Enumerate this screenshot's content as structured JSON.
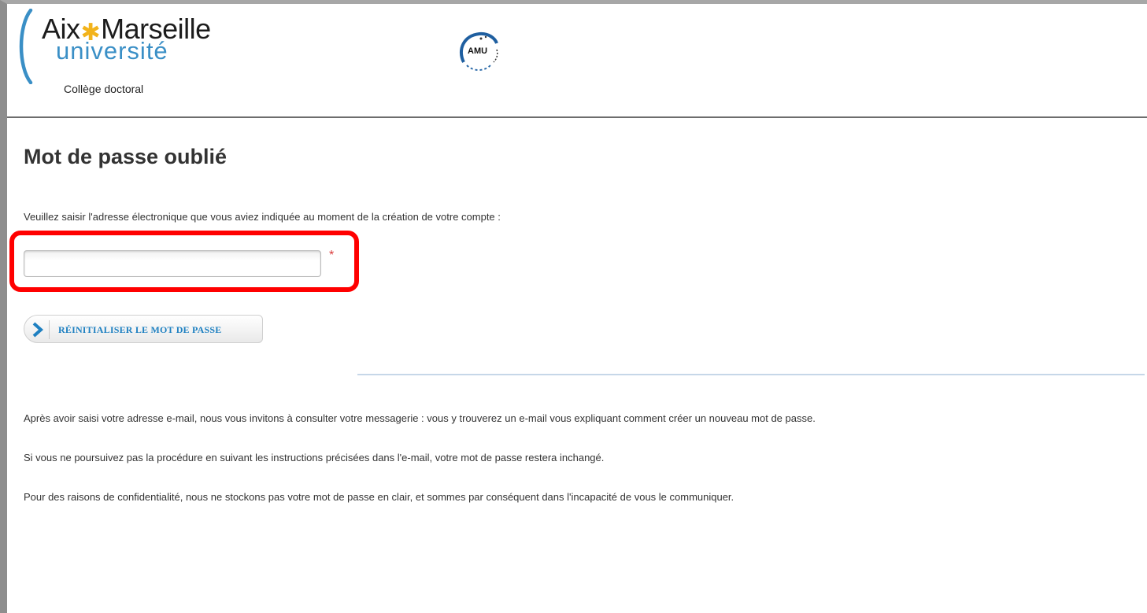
{
  "header": {
    "brand_line1_left": "Aix",
    "brand_line1_right": "Marseille",
    "brand_line2": "université",
    "brand_line3": "Collège doctoral",
    "seal_text": "AMU"
  },
  "main": {
    "title": "Mot de passe oublié",
    "instruction": "Veuillez saisir l'adresse électronique que vous aviez indiquée au moment de la création de votre compte :",
    "email_input": {
      "value": "",
      "placeholder": ""
    },
    "required_mark": "*",
    "reset_button_label": "RÉINITIALISER LE MOT DE PASSE",
    "info_paragraphs": [
      "Après avoir saisi votre adresse e-mail, nous vous invitons à consulter votre messagerie : vous y trouverez un e-mail vous expliquant comment créer un nouveau mot de passe.",
      "Si vous ne poursuivez pas la procédure en suivant les instructions précisées dans l'e-mail, votre mot de passe restera inchangé.",
      "Pour des raisons de confidentialité, nous ne stockons pas votre mot de passe en clair, et sommes par conséquent dans l'incapacité de vous le communiquer."
    ]
  },
  "icons": {
    "button_chevron": "chevron-right-icon",
    "brand_star": "asterisk-icon"
  },
  "colors": {
    "brand_blue": "#3a8fc6",
    "brand_star": "#f2b31b",
    "button_text": "#1e80c1",
    "required": "#d93a3a",
    "highlight": "#ff0000"
  }
}
